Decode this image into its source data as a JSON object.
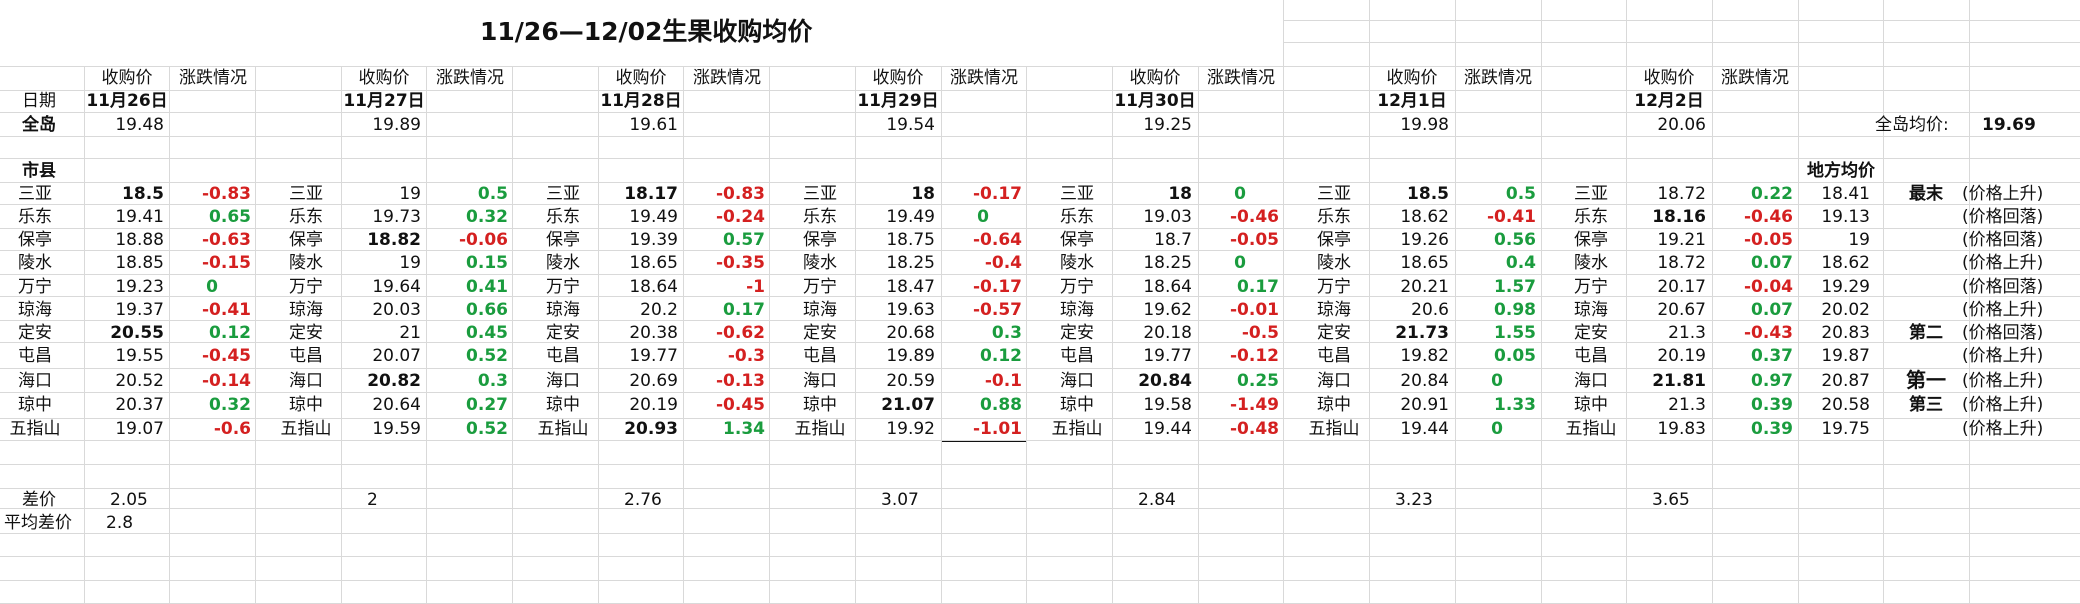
{
  "title": "11/26—12/02生果收购均价",
  "labels": {
    "price": "收购价",
    "change": "涨跌情况",
    "date": "日期",
    "island": "全岛",
    "county": "市县",
    "spread": "差价",
    "avg_spread": "平均差价",
    "island_avg_label": "全岛均价:",
    "island_avg_value": "19.69",
    "local_avg": "地方均价"
  },
  "days": [
    {
      "date": "11月26日",
      "island": "19.48",
      "spread": "2.05",
      "rows": [
        [
          "三亚",
          "18.5",
          "-0.83"
        ],
        [
          "乐东",
          "19.41",
          "0.65"
        ],
        [
          "保亭",
          "18.88",
          "-0.63"
        ],
        [
          "陵水",
          "18.85",
          "-0.15"
        ],
        [
          "万宁",
          "19.23",
          "0"
        ],
        [
          "琼海",
          "19.37",
          "-0.41"
        ],
        [
          "定安",
          "20.55",
          "0.12"
        ],
        [
          "屯昌",
          "19.55",
          "-0.45"
        ],
        [
          "海口",
          "20.52",
          "-0.14"
        ],
        [
          "琼中",
          "20.37",
          "0.32"
        ],
        [
          "五指山",
          "19.07",
          "-0.6"
        ]
      ]
    },
    {
      "date": "11月27日",
      "island": "19.89",
      "spread": "2",
      "rows": [
        [
          "三亚",
          "19",
          "0.5"
        ],
        [
          "乐东",
          "19.73",
          "0.32"
        ],
        [
          "保亭",
          "18.82",
          "-0.06"
        ],
        [
          "陵水",
          "19",
          "0.15"
        ],
        [
          "万宁",
          "19.64",
          "0.41"
        ],
        [
          "琼海",
          "20.03",
          "0.66"
        ],
        [
          "定安",
          "21",
          "0.45"
        ],
        [
          "屯昌",
          "20.07",
          "0.52"
        ],
        [
          "海口",
          "20.82",
          "0.3"
        ],
        [
          "琼中",
          "20.64",
          "0.27"
        ],
        [
          "五指山",
          "19.59",
          "0.52"
        ]
      ]
    },
    {
      "date": "11月28日",
      "island": "19.61",
      "spread": "2.76",
      "rows": [
        [
          "三亚",
          "18.17",
          "-0.83"
        ],
        [
          "乐东",
          "19.49",
          "-0.24"
        ],
        [
          "保亭",
          "19.39",
          "0.57"
        ],
        [
          "陵水",
          "18.65",
          "-0.35"
        ],
        [
          "万宁",
          "18.64",
          "-1"
        ],
        [
          "琼海",
          "20.2",
          "0.17"
        ],
        [
          "定安",
          "20.38",
          "-0.62"
        ],
        [
          "屯昌",
          "19.77",
          "-0.3"
        ],
        [
          "海口",
          "20.69",
          "-0.13"
        ],
        [
          "琼中",
          "20.19",
          "-0.45"
        ],
        [
          "五指山",
          "20.93",
          "1.34"
        ]
      ]
    },
    {
      "date": "11月29日",
      "island": "19.54",
      "spread": "3.07",
      "rows": [
        [
          "三亚",
          "18",
          "-0.17"
        ],
        [
          "乐东",
          "19.49",
          "0"
        ],
        [
          "保亭",
          "18.75",
          "-0.64"
        ],
        [
          "陵水",
          "18.25",
          "-0.4"
        ],
        [
          "万宁",
          "18.47",
          "-0.17"
        ],
        [
          "琼海",
          "19.63",
          "-0.57"
        ],
        [
          "定安",
          "20.68",
          "0.3"
        ],
        [
          "屯昌",
          "19.89",
          "0.12"
        ],
        [
          "海口",
          "20.59",
          "-0.1"
        ],
        [
          "琼中",
          "21.07",
          "0.88"
        ],
        [
          "五指山",
          "19.92",
          "-1.01"
        ]
      ]
    },
    {
      "date": "11月30日",
      "island": "19.25",
      "spread": "2.84",
      "rows": [
        [
          "三亚",
          "18",
          "0"
        ],
        [
          "乐东",
          "19.03",
          "-0.46"
        ],
        [
          "保亭",
          "18.7",
          "-0.05"
        ],
        [
          "陵水",
          "18.25",
          "0"
        ],
        [
          "万宁",
          "18.64",
          "0.17"
        ],
        [
          "琼海",
          "19.62",
          "-0.01"
        ],
        [
          "定安",
          "20.18",
          "-0.5"
        ],
        [
          "屯昌",
          "19.77",
          "-0.12"
        ],
        [
          "海口",
          "20.84",
          "0.25"
        ],
        [
          "琼中",
          "19.58",
          "-1.49"
        ],
        [
          "五指山",
          "19.44",
          "-0.48"
        ]
      ]
    },
    {
      "date": "12月1日",
      "island": "19.98",
      "spread": "3.23",
      "rows": [
        [
          "三亚",
          "18.5",
          "0.5"
        ],
        [
          "乐东",
          "18.62",
          "-0.41"
        ],
        [
          "保亭",
          "19.26",
          "0.56"
        ],
        [
          "陵水",
          "18.65",
          "0.4"
        ],
        [
          "万宁",
          "20.21",
          "1.57"
        ],
        [
          "琼海",
          "20.6",
          "0.98"
        ],
        [
          "定安",
          "21.73",
          "1.55"
        ],
        [
          "屯昌",
          "19.82",
          "0.05"
        ],
        [
          "海口",
          "20.84",
          "0"
        ],
        [
          "琼中",
          "20.91",
          "1.33"
        ],
        [
          "五指山",
          "19.44",
          "0"
        ]
      ]
    },
    {
      "date": "12月2日",
      "island": "20.06",
      "spread": "3.65",
      "rows": [
        [
          "三亚",
          "18.72",
          "0.22"
        ],
        [
          "乐东",
          "18.16",
          "-0.46"
        ],
        [
          "保亭",
          "19.21",
          "-0.05"
        ],
        [
          "陵水",
          "18.72",
          "0.07"
        ],
        [
          "万宁",
          "20.17",
          "-0.04"
        ],
        [
          "琼海",
          "20.67",
          "0.07"
        ],
        [
          "定安",
          "21.3",
          "-0.43"
        ],
        [
          "屯昌",
          "20.19",
          "0.37"
        ],
        [
          "海口",
          "21.81",
          "0.97"
        ],
        [
          "琼中",
          "21.3",
          "0.39"
        ],
        [
          "五指山",
          "19.83",
          "0.39"
        ]
      ]
    }
  ],
  "avg_spread_value": "2.8",
  "local": [
    {
      "avg": "18.41",
      "rank": "最末",
      "trend": "(价格上升)"
    },
    {
      "avg": "19.13",
      "rank": "",
      "trend": "(价格回落)"
    },
    {
      "avg": "19",
      "rank": "",
      "trend": "(价格回落)"
    },
    {
      "avg": "18.62",
      "rank": "",
      "trend": "(价格上升)"
    },
    {
      "avg": "19.29",
      "rank": "",
      "trend": "(价格回落)"
    },
    {
      "avg": "20.02",
      "rank": "",
      "trend": "(价格上升)"
    },
    {
      "avg": "20.83",
      "rank": "第二",
      "trend": "(价格回落)"
    },
    {
      "avg": "19.87",
      "rank": "",
      "trend": "(价格上升)"
    },
    {
      "avg": "20.87",
      "rank": "第一",
      "trend": "(价格上升)"
    },
    {
      "avg": "20.58",
      "rank": "第三",
      "trend": "(价格上升)"
    },
    {
      "avg": "19.75",
      "rank": "",
      "trend": "(价格上升)"
    }
  ],
  "bold_prices": [
    [
      0,
      0
    ],
    [
      0,
      6
    ],
    [
      1,
      2
    ],
    [
      1,
      8
    ],
    [
      2,
      0
    ],
    [
      2,
      10
    ],
    [
      3,
      0
    ],
    [
      3,
      9
    ],
    [
      4,
      0
    ],
    [
      4,
      8
    ],
    [
      5,
      0
    ],
    [
      5,
      6
    ],
    [
      6,
      1
    ],
    [
      6,
      8
    ]
  ],
  "colors": {
    "up": "#1a9c3e",
    "down": "#d42020",
    "grid": "#d9d9d9"
  }
}
